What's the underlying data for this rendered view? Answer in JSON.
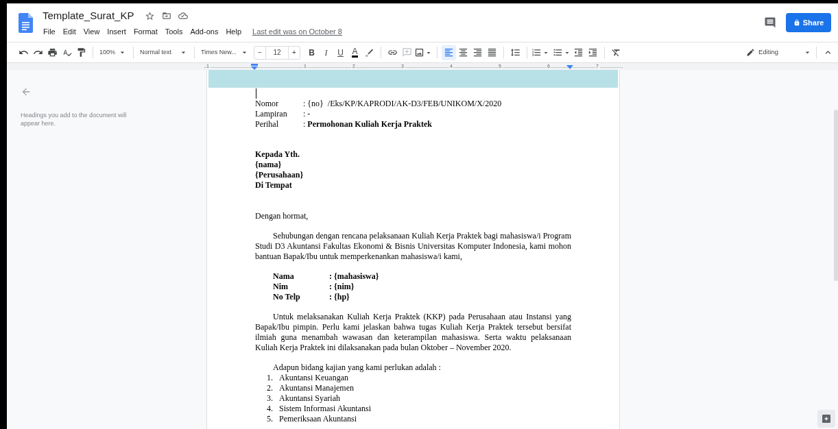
{
  "document_title": "Template_Surat_KP",
  "menus": [
    "File",
    "Edit",
    "View",
    "Insert",
    "Format",
    "Tools",
    "Add-ons",
    "Help"
  ],
  "last_edit": "Last edit was on October 8",
  "share_button": "Share",
  "toolbar": {
    "zoom": "100%",
    "paragraph_style": "Normal text",
    "font": "Times New...",
    "size_minus": "−",
    "font_size": "12",
    "size_plus": "+",
    "text_styles": [
      "B",
      "I",
      "U",
      "A"
    ],
    "alignments": [
      {
        "selected": true
      },
      {
        "selected": false
      },
      {
        "selected": false
      },
      {
        "selected": false
      }
    ],
    "mode": "Editing"
  },
  "ruler": [
    "1",
    "1",
    "2",
    "3",
    "4",
    "5",
    "6",
    "7"
  ],
  "outline": {
    "message": "Headings you add to the document will appear here."
  },
  "document": {
    "header_fields": [
      {
        "label": "Nomor",
        "value": ": {no}  /Eks/KP/KAPRODI/AK-D3/FEB/UNIKOM/X/2020"
      },
      {
        "label": "Lampiran",
        "value": ": -"
      },
      {
        "label": "Perihal",
        "value": ": **Permohonan Kuliah Kerja Praktek**"
      }
    ],
    "recipient": [
      "Kepada Yth.",
      "{nama}",
      "{Perusahaan}",
      "Di Tempat"
    ],
    "greeting": "Dengan hormat,",
    "paragraph_1": "Sehubungan dengan rencana pelaksanaan Kuliah Kerja Praktek bagi mahasiswa/i Program Studi D3 Akuntansi Fakultas Ekonomi & Bisnis Universitas Komputer Indonesia, kami mohon bantuan Bapak/Ibu untuk memperkenankan mahasiswa/i kami,",
    "student_fields": [
      {
        "label": "Nama",
        "value": ": {mahasiswa}"
      },
      {
        "label": "Nim",
        "value": ": {nim}"
      },
      {
        "label": "No Telp",
        "value": ": {hp}"
      }
    ],
    "paragraph_2": "Untuk melaksanakan Kuliah Kerja Praktek (KKP) pada Perusahaan atau Instansi yang Bapak/Ibu pimpin. Perlu kami jelaskan bahwa tugas Kuliah Kerja Praktek tersebut bersifat ilmiah guna menambah wawasan dan keterampilan mahasiswa. Serta waktu pelaksanaan Kuliah Kerja Praktek ini dilaksanakan pada bulan Oktober – November 2020.",
    "list_intro": "Adapun bidang kajian yang kami perlukan adalah :",
    "study_areas": [
      {
        "number": "1.",
        "text": "Akuntansi Keuangan"
      },
      {
        "number": "2.",
        "text": "Akuntansi Manajemen"
      },
      {
        "number": "3.",
        "text": "Akuntansi Syariah"
      },
      {
        "number": "4.",
        "text": "Sistem Informasi Akuntansi"
      },
      {
        "number": "5.",
        "text": "Pemeriksaan Akuntansi"
      }
    ]
  }
}
